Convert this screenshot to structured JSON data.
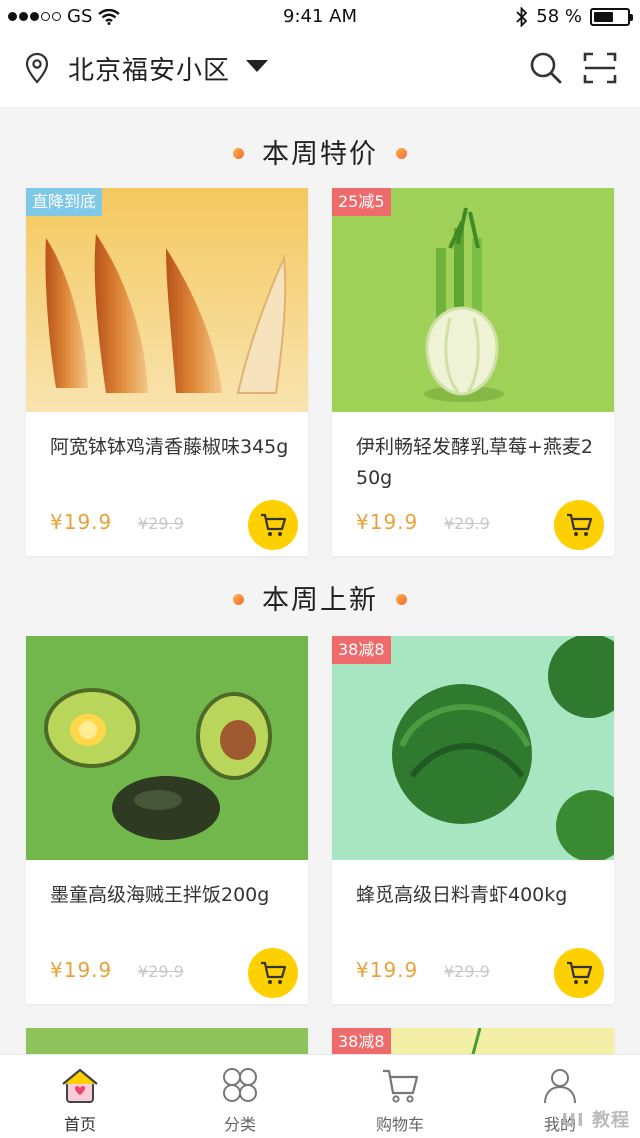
{
  "status_bar": {
    "carrier": "GS",
    "time": "9:41 AM",
    "battery": "58 %",
    "battery_level": 0.58
  },
  "header": {
    "location": "北京福安小区"
  },
  "sections": [
    {
      "title": "本周特价"
    },
    {
      "title": "本周上新"
    }
  ],
  "products": [
    {
      "badge": "直降到底",
      "name": "阿宽钵钵鸡清香藤椒味345g",
      "price": "¥19.9",
      "old_price": "¥29.9"
    },
    {
      "badge": "25减5",
      "name": "伊利畅轻发酵乳草莓+燕麦250g",
      "price": "¥19.9",
      "old_price": "¥29.9"
    },
    {
      "badge": "",
      "name": "墨童高级海贼王拌饭200g",
      "price": "¥19.9",
      "old_price": "¥29.9"
    },
    {
      "badge": "38减8",
      "name": "蜂觅高级日料青虾400kg",
      "price": "¥19.9",
      "old_price": "¥29.9"
    },
    {
      "badge": "38减8"
    }
  ],
  "tabbar": {
    "home": "首页",
    "category": "分类",
    "cart": "购物车",
    "mine": "我的"
  },
  "watermark": "UI 教程",
  "colors": {
    "accent_yellow": "#ffd000",
    "price_orange": "#e8a237",
    "badge_blue": "#7ec8e8",
    "badge_red": "#ef6a6a"
  }
}
